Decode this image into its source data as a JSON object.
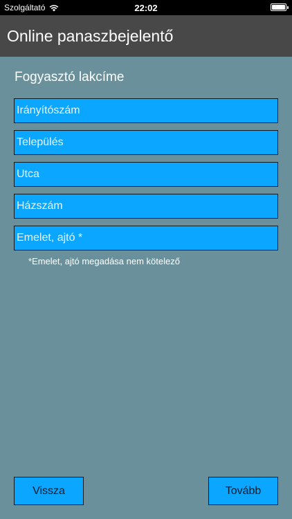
{
  "status_bar": {
    "carrier": "Szolgáltató",
    "time": "22:02",
    "wifi_icon": "wifi-icon",
    "battery_icon": "battery-icon"
  },
  "nav": {
    "title": "Online panaszbejelentő"
  },
  "form": {
    "section_title": "Fogyasztó lakcíme",
    "fields": [
      {
        "placeholder": "Irányítószám",
        "value": ""
      },
      {
        "placeholder": "Település",
        "value": ""
      },
      {
        "placeholder": "Utca",
        "value": ""
      },
      {
        "placeholder": "Házszám",
        "value": ""
      },
      {
        "placeholder": "Emelet, ajtó *",
        "value": ""
      }
    ],
    "note": "*Emelet, ajtó megadása nem kötelező"
  },
  "buttons": {
    "back_label": "Vissza",
    "next_label": "Tovább"
  },
  "colors": {
    "background": "#6a919b",
    "nav_bar": "#484848",
    "field_fill": "#0aa6ff",
    "status_bar": "#000000"
  }
}
